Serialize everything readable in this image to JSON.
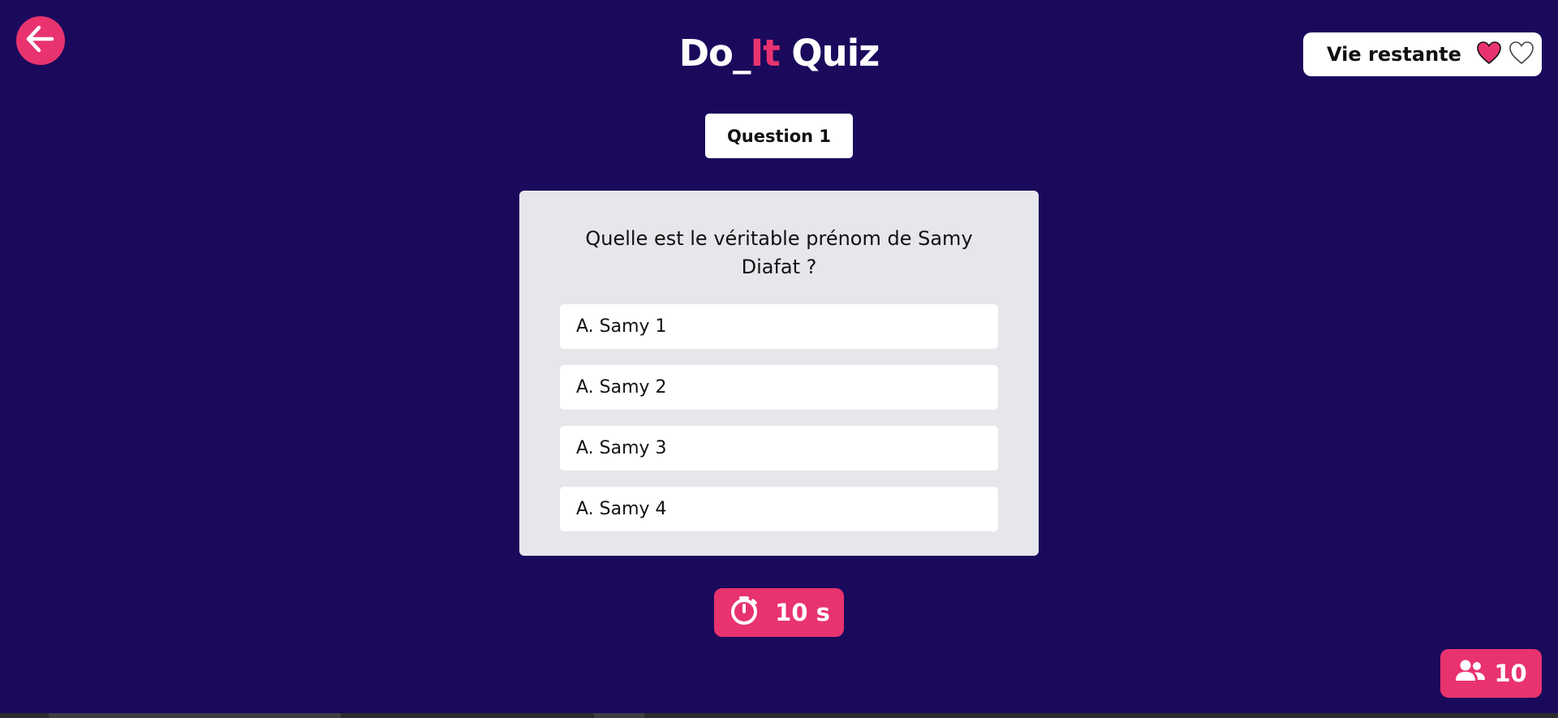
{
  "header": {
    "title_part_1": "Do_",
    "title_part_accent": "It",
    "title_part_2": " Quiz",
    "back_button_icon": "arrow-left-circle-icon"
  },
  "lives": {
    "label": "Vie restante",
    "hearts": [
      "filled",
      "outline"
    ],
    "heart_filled_color": "#e8336f",
    "heart_outline_color": "#444444"
  },
  "question": {
    "badge_label": "Question 1",
    "text": "Quelle est le véritable prénom de Samy Diafat ?",
    "answers": [
      {
        "label": "A. Samy 1"
      },
      {
        "label": "A. Samy 2"
      },
      {
        "label": "A. Samy 3"
      },
      {
        "label": "A. Samy 4"
      }
    ]
  },
  "timer": {
    "icon": "stopwatch-icon",
    "value": "10 s"
  },
  "players": {
    "icon": "users-icon",
    "count": "10"
  },
  "colors": {
    "background": "#1b0a5c",
    "accent": "#e8336f",
    "card": "#e6e7eb",
    "white": "#ffffff"
  }
}
